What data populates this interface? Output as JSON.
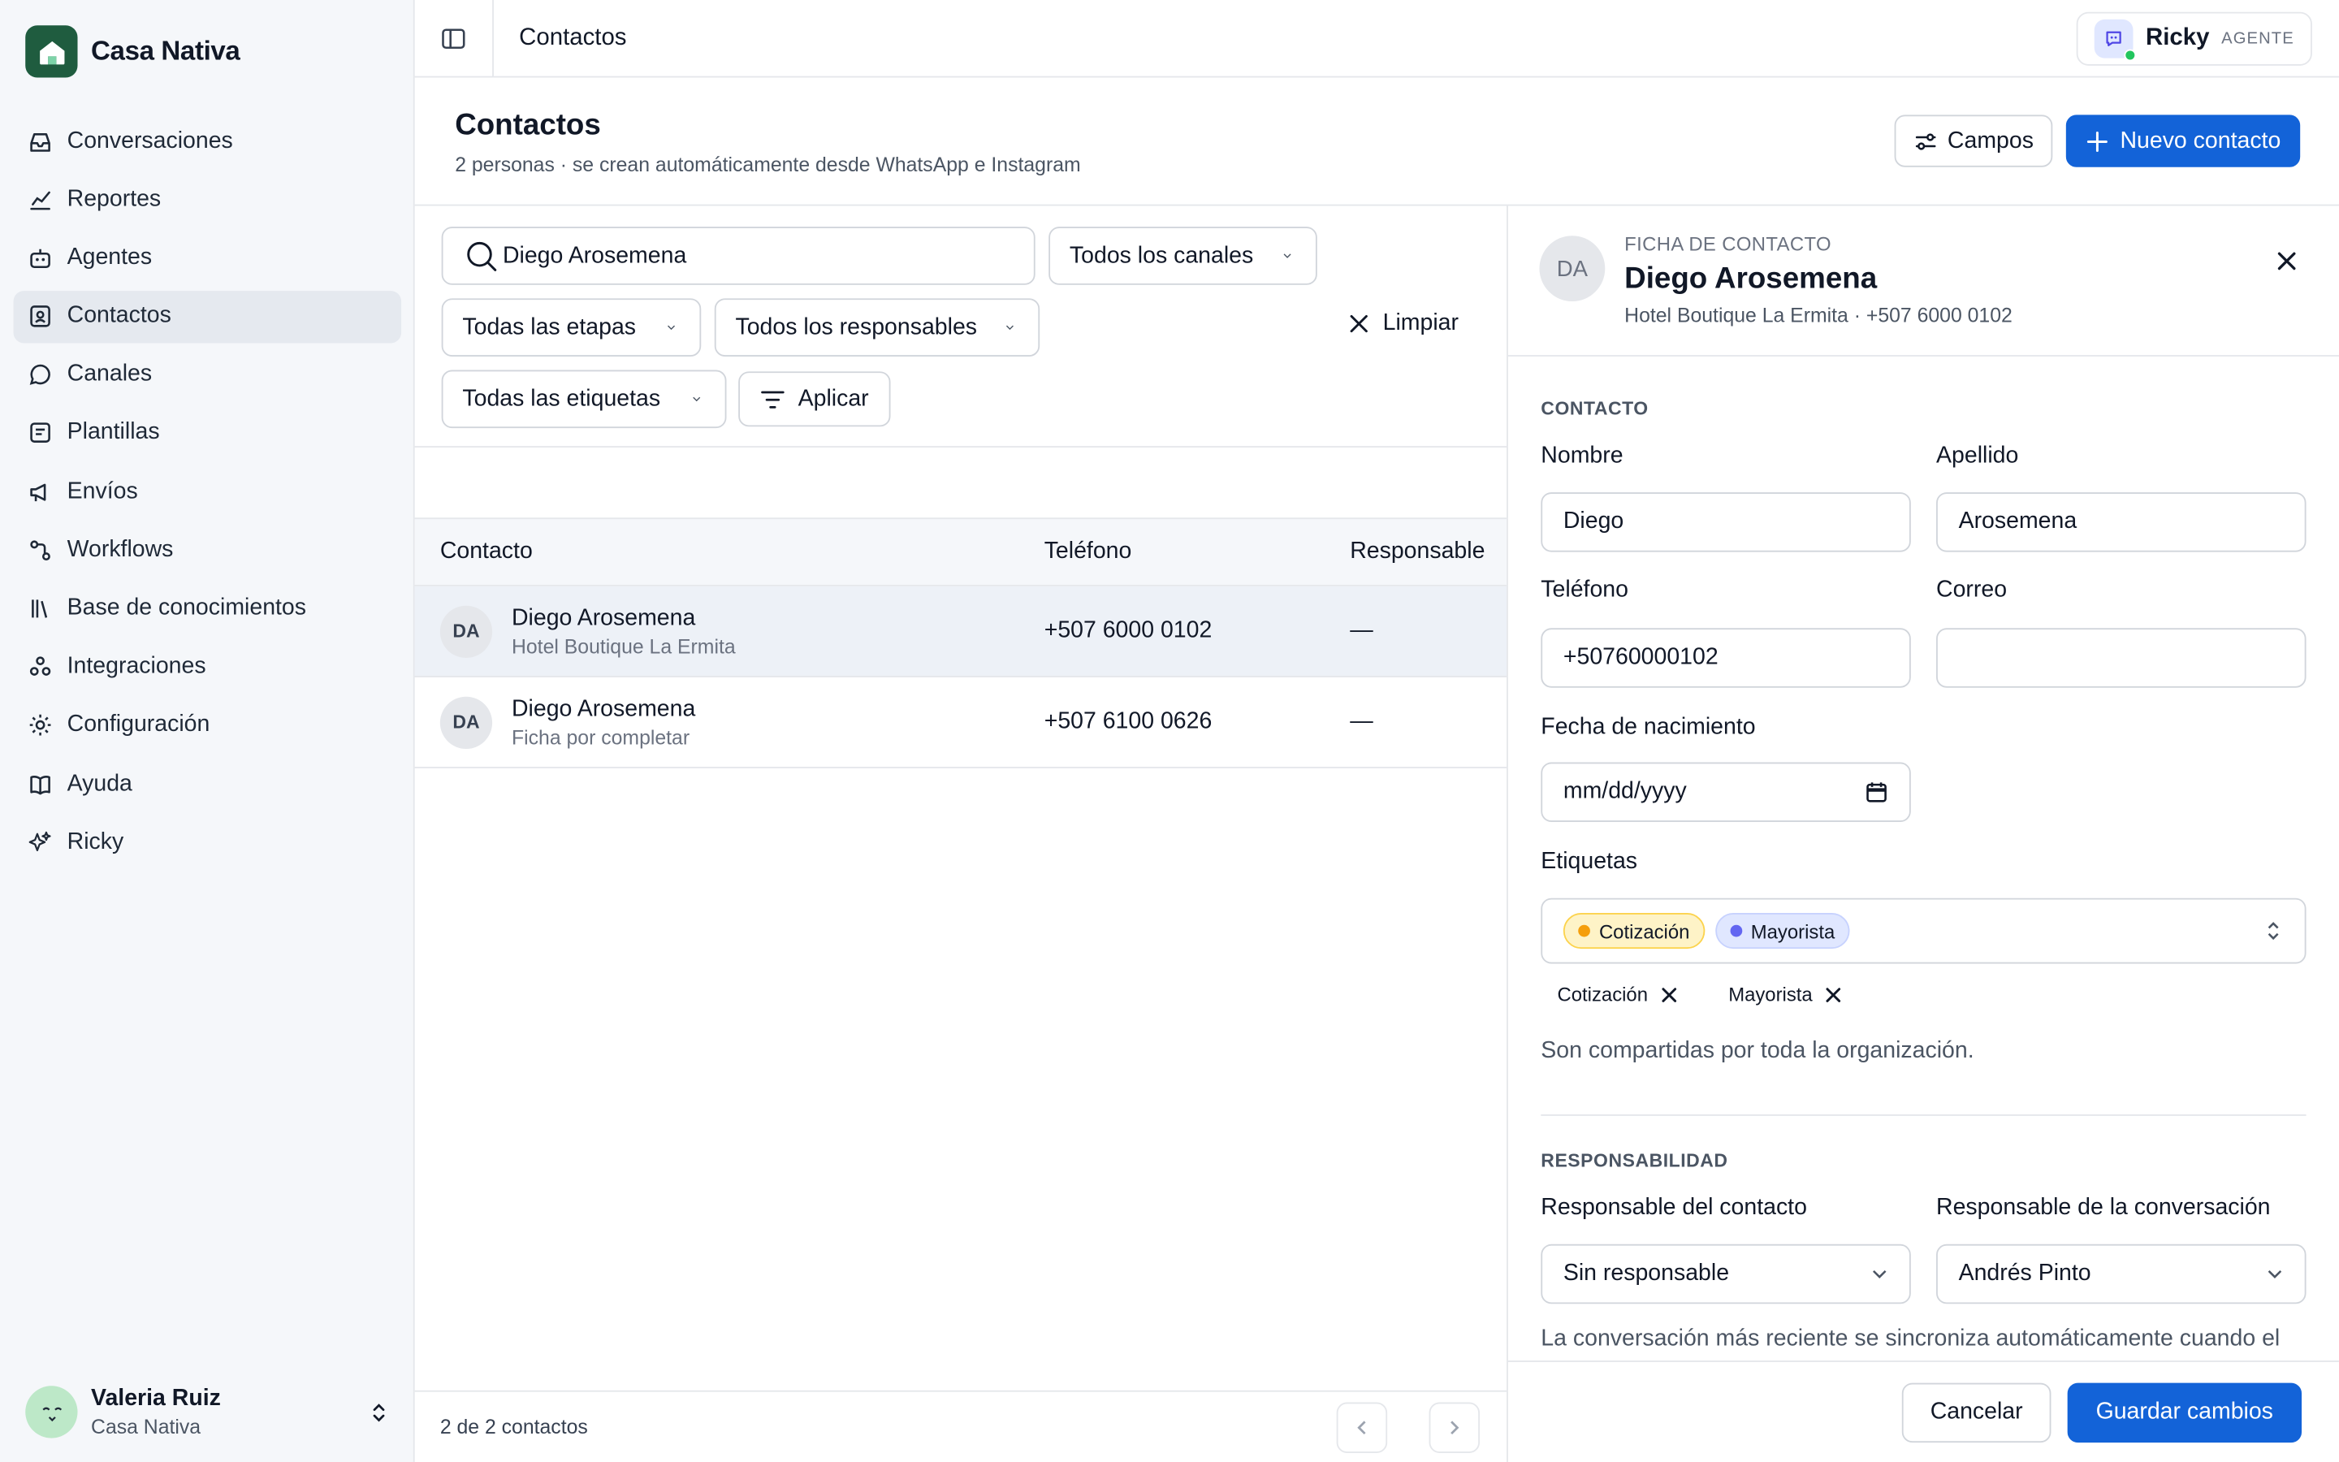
{
  "brand": {
    "name": "Casa Nativa"
  },
  "nav": [
    {
      "label": "Conversaciones",
      "icon": "inbox-icon"
    },
    {
      "label": "Reportes",
      "icon": "chart-icon"
    },
    {
      "label": "Agentes",
      "icon": "bot-icon"
    },
    {
      "label": "Contactos",
      "icon": "contact-card-icon",
      "active": true
    },
    {
      "label": "Canales",
      "icon": "chat-bubble-icon"
    },
    {
      "label": "Plantillas",
      "icon": "template-icon"
    },
    {
      "label": "Envíos",
      "icon": "megaphone-icon"
    },
    {
      "label": "Workflows",
      "icon": "workflow-icon"
    },
    {
      "label": "Base de conocimientos",
      "icon": "library-icon"
    },
    {
      "label": "Integraciones",
      "icon": "integrations-icon"
    },
    {
      "label": "Configuración",
      "icon": "gear-icon"
    },
    {
      "label": "Ayuda",
      "icon": "book-icon"
    },
    {
      "label": "Ricky",
      "icon": "sparkles-icon"
    }
  ],
  "user": {
    "name": "Valeria Ruiz",
    "org": "Casa Nativa",
    "avatar": "˘ ˘\nv"
  },
  "topbar": {
    "breadcrumb": "Contactos",
    "agent_name": "Ricky",
    "agent_role": "AGENTE"
  },
  "page": {
    "title": "Contactos",
    "subtitle": "2 personas · se crean automáticamente desde WhatsApp e Instagram",
    "fields_button": "Campos",
    "new_button": "Nuevo contacto"
  },
  "filters": {
    "search_value": "Diego Arosemena",
    "channels": "Todos los canales",
    "stages": "Todas las etapas",
    "owners": "Todos los responsables",
    "tags": "Todas las etiquetas",
    "apply": "Aplicar",
    "clear": "Limpiar"
  },
  "table": {
    "headers": [
      "Contacto",
      "Teléfono",
      "Responsable"
    ],
    "rows": [
      {
        "initials": "DA",
        "name": "Diego Arosemena",
        "sub": "Hotel Boutique La Ermita",
        "phone": "+507 6000 0102",
        "owner": "—",
        "selected": true
      },
      {
        "initials": "DA",
        "name": "Diego Arosemena",
        "sub": "Ficha por completar",
        "phone": "+507 6100 0626",
        "owner": "—"
      }
    ],
    "count": "2 de 2 contactos"
  },
  "panel": {
    "initials": "DA",
    "kicker": "FICHA DE CONTACTO",
    "name": "Diego Arosemena",
    "sub": "Hotel Boutique La Ermita · +507 6000 0102",
    "section_contact": "CONTACTO",
    "first_name_label": "Nombre",
    "first_name": "Diego",
    "last_name_label": "Apellido",
    "last_name": "Arosemena",
    "phone_label": "Teléfono",
    "phone": "+50760000102",
    "email_label": "Correo",
    "email": "",
    "birth_label": "Fecha de nacimiento",
    "birth_placeholder": "mm/dd/yyyy",
    "tags_label": "Etiquetas",
    "tags": [
      {
        "label": "Cotización",
        "color": "#f59e0b",
        "bg": "#fef3c7",
        "border": "#fcd34d"
      },
      {
        "label": "Mayorista",
        "color": "#6366f1",
        "bg": "#e0e7ff",
        "border": "#c7d2fe"
      }
    ],
    "tags_note": "Son compartidas por toda la organización.",
    "section_owner": "RESPONSABILIDAD",
    "contact_owner_label": "Responsable del contacto",
    "contact_owner": "Sin responsable",
    "conv_owner_label": "Responsable de la conversación",
    "conv_owner": "Andrés Pinto",
    "sync_note": "La conversación más reciente se sincroniza automáticamente cuando el",
    "cancel": "Cancelar",
    "save": "Guardar cambios"
  },
  "colors": {
    "primary": "#1363d8",
    "brand": "#1f5c3f",
    "online": "#22c55e"
  }
}
